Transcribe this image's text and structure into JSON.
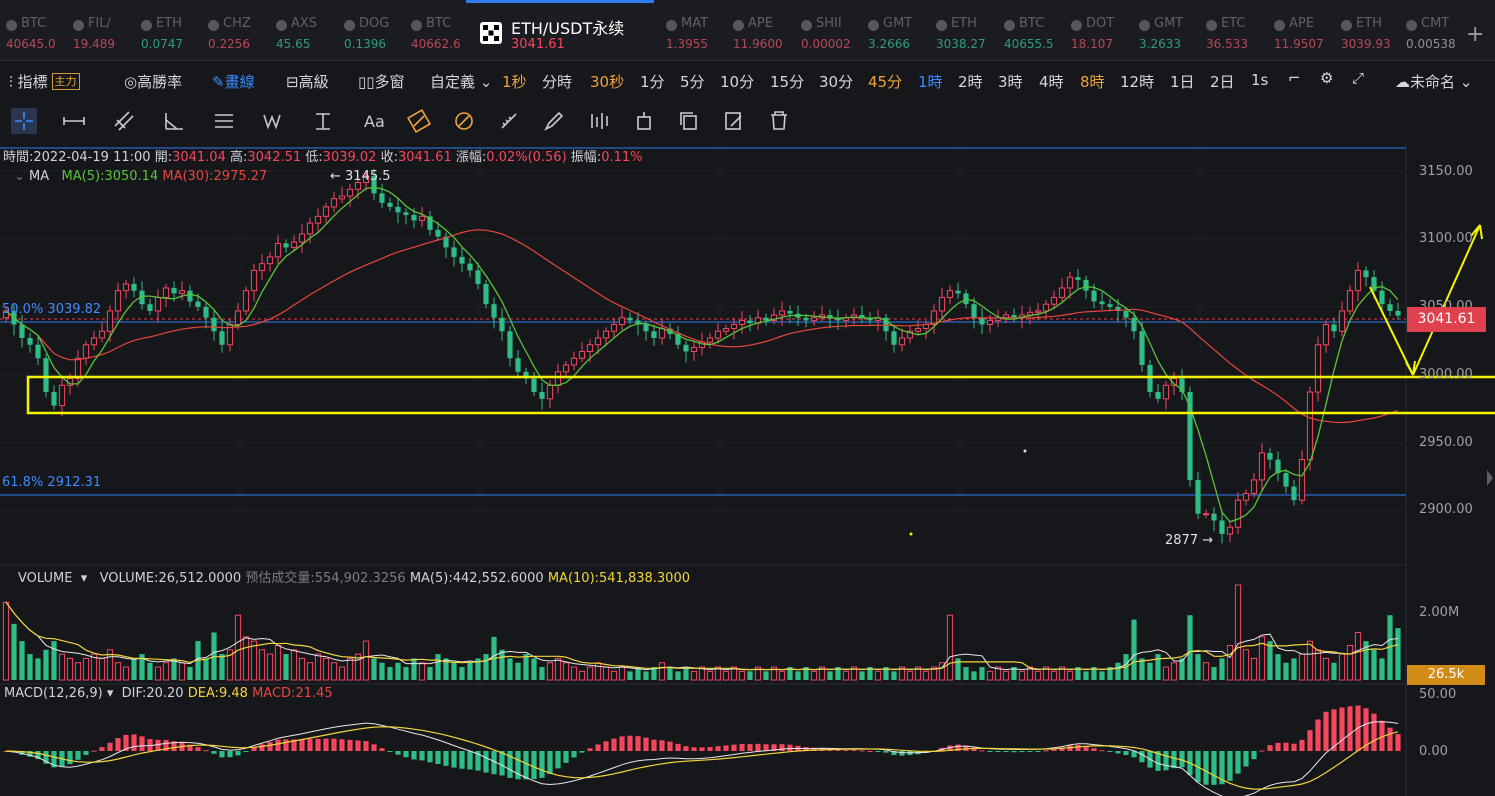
{
  "tabs": [
    {
      "name": "BTC",
      "price": "40645.0",
      "dir": "up"
    },
    {
      "name": "FIL/",
      "price": "19.489",
      "dir": "up"
    },
    {
      "name": "ETH",
      "price": "0.0747",
      "dir": "dn"
    },
    {
      "name": "CHZ",
      "price": "0.2256",
      "dir": "up"
    },
    {
      "name": "AXS",
      "price": "45.65",
      "dir": "dn"
    },
    {
      "name": "DOG",
      "price": "0.1396",
      "dir": "dn"
    },
    {
      "name": "BTC",
      "price": "40662.6",
      "dir": "up"
    },
    {
      "name": "MAT",
      "price": "1.3955",
      "dir": "up"
    },
    {
      "name": "APE",
      "price": "11.9600",
      "dir": "up"
    },
    {
      "name": "SHII",
      "price": "0.00002",
      "dir": "up"
    },
    {
      "name": "GMT",
      "price": "3.2666",
      "dir": "dn"
    },
    {
      "name": "ETH",
      "price": "3038.27",
      "dir": "dn"
    },
    {
      "name": "BTC",
      "price": "40655.5",
      "dir": "dn"
    },
    {
      "name": "DOT",
      "price": "18.107",
      "dir": "up"
    },
    {
      "name": "GMT",
      "price": "3.2633",
      "dir": "dn"
    },
    {
      "name": "ETC",
      "price": "36.533",
      "dir": "up"
    },
    {
      "name": "APE",
      "price": "11.9507",
      "dir": "up"
    },
    {
      "name": "ETH",
      "price": "3039.93",
      "dir": "up"
    },
    {
      "name": "CMT",
      "price": "0.00538",
      "dir": "gr"
    }
  ],
  "active_tab": {
    "name": "ETH/USDT永续",
    "price": "3041.61"
  },
  "toolbar": {
    "indicator": "指標",
    "main": "主力",
    "winrate": "高勝率",
    "draw": "畫線",
    "advanced": "高級",
    "multi": "多窗",
    "custom": "自定義",
    "intervals": [
      "1秒",
      "分時",
      "30秒",
      "1分",
      "5分",
      "10分",
      "15分",
      "30分",
      "45分",
      "1時",
      "2時",
      "3時",
      "4時",
      "8時",
      "12時",
      "1日",
      "2日",
      "1s"
    ],
    "cloud": "未命名"
  },
  "info": {
    "time_label": "時間:",
    "time": "2022-04-19 11:00",
    "open_label": "開:",
    "open": "3041.04",
    "high_label": "高:",
    "high": "3042.51",
    "low_label": "低:",
    "low": "3039.02",
    "close_label": "收:",
    "close": "3041.61",
    "chg_label": "漲幅:",
    "chg": "0.02%(0.56)",
    "amp_label": "振幅:",
    "amp": "0.11%"
  },
  "ma": {
    "name": "MA",
    "ma5": "MA(5):3050.14",
    "ma30": "MA(30):2975.27"
  },
  "price_axis": [
    "3150.00",
    "3100.00",
    "3050.00",
    "3000.00",
    "2950.00",
    "2900.00"
  ],
  "current_price": "3041.61",
  "fib": {
    "f50": "50.0% 3039.82",
    "f618": "61.8% 2912.31"
  },
  "annotations": {
    "high": "← 3145.5",
    "low": "2877 →"
  },
  "volume": {
    "name": "VOLUME",
    "vol": "VOLUME:26,512.0000",
    "est": "预估成交量:554,902.3256",
    "ma5": "MA(5):442,552.6000",
    "ma10": "MA(10):541,838.3000",
    "axis": "2.00M",
    "tag": "26.5k"
  },
  "macd": {
    "name": "MACD(12,26,9)",
    "dif": "DIF:20.20",
    "dea": "DEA:9.48",
    "macd": "MACD:21.45",
    "axis_top": "50.00",
    "axis_zero": "0.00"
  },
  "colors": {
    "up": "#f6465d",
    "down": "#2ebd85",
    "ma5": "#5ac33a",
    "ma30": "#e6473e",
    "fib": "#2f7cf6",
    "annotation": "#f5f500"
  },
  "chart_data": {
    "type": "candlestick",
    "ylim": [
      2860,
      3170
    ],
    "closes": [
      3045,
      3035,
      3025,
      3020,
      3010,
      2985,
      2975,
      2990,
      2995,
      3010,
      3020,
      3025,
      3030,
      3045,
      3060,
      3065,
      3060,
      3050,
      3045,
      3055,
      3062,
      3058,
      3060,
      3052,
      3048,
      3040,
      3030,
      3020,
      3035,
      3045,
      3060,
      3075,
      3080,
      3085,
      3095,
      3092,
      3096,
      3102,
      3110,
      3115,
      3122,
      3128,
      3130,
      3135,
      3140,
      3145,
      3132,
      3125,
      3122,
      3118,
      3116,
      3112,
      3115,
      3105,
      3100,
      3092,
      3085,
      3080,
      3075,
      3065,
      3050,
      3040,
      3030,
      3010,
      3000,
      2995,
      2985,
      2980,
      2990,
      3000,
      3005,
      3010,
      3015,
      3020,
      3025,
      3030,
      3035,
      3040,
      3038,
      3035,
      3030,
      3025,
      3032,
      3028,
      3020,
      3015,
      3018,
      3022,
      3025,
      3030,
      3032,
      3035,
      3038,
      3036,
      3040,
      3038,
      3042,
      3045,
      3043,
      3040,
      3038,
      3040,
      3042,
      3040,
      3038,
      3040,
      3042,
      3040,
      3038,
      3040,
      3030,
      3020,
      3025,
      3030,
      3032,
      3035,
      3045,
      3055,
      3060,
      3058,
      3050,
      3040,
      3035,
      3038,
      3040,
      3042,
      3040,
      3042,
      3044,
      3045,
      3050,
      3055,
      3062,
      3070,
      3068,
      3060,
      3052,
      3050,
      3048,
      3045,
      3040,
      3030,
      3005,
      2985,
      2980,
      2990,
      2995,
      2985,
      2920,
      2895,
      2895,
      2890,
      2880,
      2885,
      2905,
      2910,
      2920,
      2940,
      2935,
      2925,
      2915,
      2905,
      2935,
      2985,
      3020,
      3035,
      3030,
      3045,
      3060,
      3075,
      3070,
      3060,
      3050,
      3045,
      3041.61
    ],
    "volumes": [
      1.8,
      1.3,
      0.9,
      0.6,
      0.5,
      0.7,
      0.9,
      0.6,
      0.5,
      0.4,
      0.5,
      0.6,
      0.5,
      0.7,
      0.4,
      0.3,
      0.5,
      0.6,
      0.4,
      0.3,
      0.4,
      0.5,
      0.4,
      0.3,
      0.9,
      0.5,
      1.1,
      0.6,
      0.7,
      1.5,
      1.0,
      0.9,
      0.7,
      0.6,
      0.8,
      0.6,
      0.7,
      0.5,
      0.4,
      0.6,
      0.5,
      0.4,
      0.3,
      0.5,
      0.6,
      0.9,
      0.5,
      0.4,
      0.3,
      0.4,
      0.3,
      0.5,
      0.4,
      0.3,
      0.6,
      0.5,
      0.4,
      0.3,
      0.4,
      0.5,
      0.6,
      1.0,
      0.7,
      0.5,
      0.4,
      0.6,
      0.5,
      0.3,
      0.4,
      0.5,
      0.4,
      0.3,
      0.2,
      0.3,
      0.4,
      0.3,
      0.2,
      0.3,
      0.2,
      0.3,
      0.2,
      0.3,
      0.4,
      0.3,
      0.2,
      0.3,
      0.2,
      0.3,
      0.2,
      0.3,
      0.2,
      0.3,
      0.2,
      0.2,
      0.3,
      0.2,
      0.3,
      0.2,
      0.3,
      0.2,
      0.3,
      0.2,
      0.3,
      0.2,
      0.3,
      0.2,
      0.3,
      0.2,
      0.3,
      0.2,
      0.3,
      0.2,
      0.3,
      0.2,
      0.3,
      0.2,
      0.3,
      0.4,
      1.5,
      0.5,
      0.3,
      0.2,
      0.3,
      0.2,
      0.3,
      0.2,
      0.3,
      0.2,
      0.3,
      0.2,
      0.3,
      0.2,
      0.3,
      0.2,
      0.3,
      0.2,
      0.3,
      0.2,
      0.3,
      0.4,
      0.6,
      1.4,
      0.5,
      0.4,
      0.6,
      0.3,
      0.4,
      0.5,
      1.5,
      0.6,
      0.4,
      0.3,
      0.5,
      0.8,
      2.2,
      0.7,
      0.5,
      1.0,
      0.9,
      0.6,
      0.4,
      0.5,
      0.6,
      0.9,
      0.7,
      0.5,
      0.4,
      0.6,
      0.8,
      1.1,
      0.9,
      0.7,
      0.5,
      1.5,
      1.2,
      0.9,
      0.6,
      0.4,
      0.5,
      0.3,
      0.4,
      0.2,
      0.1
    ]
  }
}
